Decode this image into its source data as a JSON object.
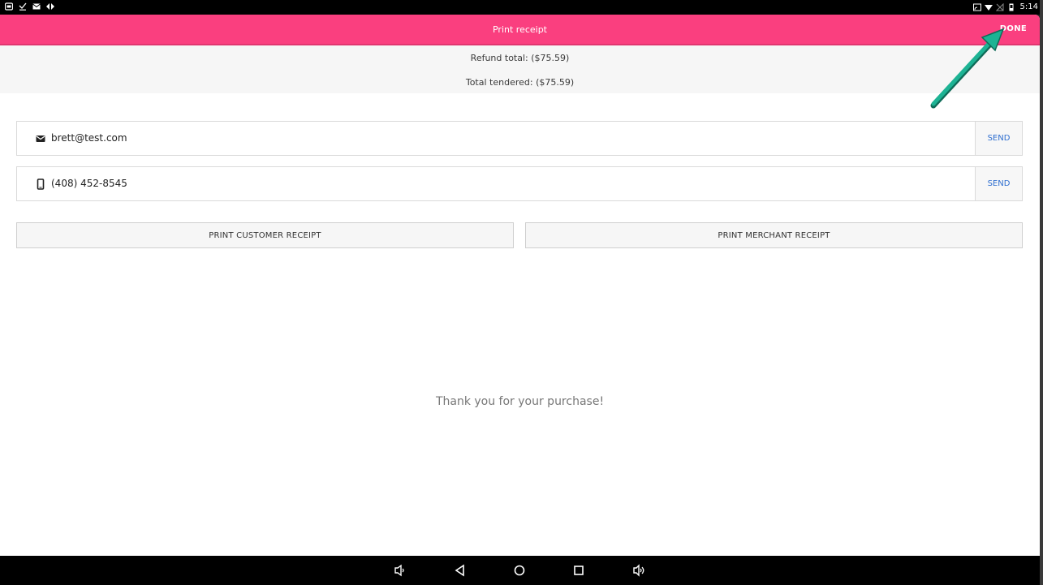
{
  "status_bar": {
    "time": "5:14",
    "left_icons": [
      "screen-cast-icon",
      "download-done-icon",
      "mail-icon",
      "sync-icon"
    ],
    "right_icons": [
      "cast-icon",
      "wifi-icon",
      "no-sim-icon",
      "battery-icon"
    ]
  },
  "app_bar": {
    "title": "Print receipt",
    "done_label": "DONE",
    "color": "#fa3f7f"
  },
  "totals": {
    "refund_total": "Refund total: ($75.59)",
    "total_tendered": "Total tendered: ($75.59)"
  },
  "email": {
    "value": "brett@test.com",
    "send_label": "SEND"
  },
  "phone": {
    "value": "(408) 452-8545",
    "send_label": "SEND"
  },
  "print": {
    "customer_label": "PRINT CUSTOMER RECEIPT",
    "merchant_label": "PRINT MERCHANT RECEIPT"
  },
  "message": "Thank you for your purchase!",
  "nav_bar": {
    "items": [
      "volume-down-icon",
      "back-icon",
      "home-icon",
      "recents-icon",
      "volume-up-icon"
    ]
  },
  "annotation": {
    "arrow_color": "#1db394"
  }
}
